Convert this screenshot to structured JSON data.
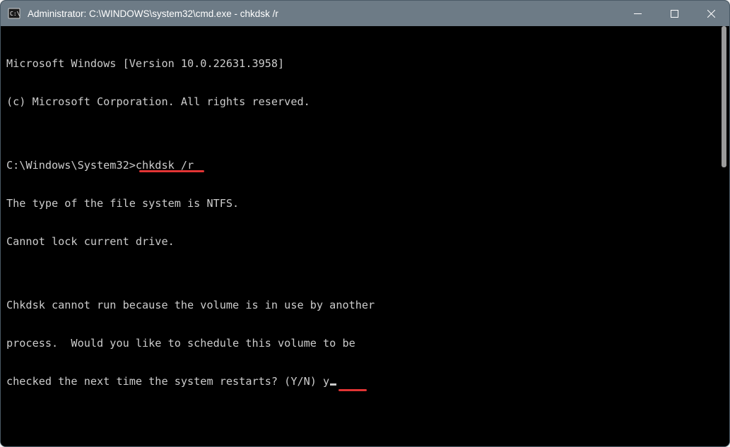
{
  "titlebar": {
    "title": "Administrator: C:\\WINDOWS\\system32\\cmd.exe - chkdsk  /r"
  },
  "terminal": {
    "line1": "Microsoft Windows [Version 10.0.22631.3958]",
    "line2": "(c) Microsoft Corporation. All rights reserved.",
    "blank1": "",
    "prompt_prefix": "C:\\Windows\\System32>",
    "prompt_command": "chkdsk /r",
    "line4": "The type of the file system is NTFS.",
    "line5": "Cannot lock current drive.",
    "blank2": "",
    "line6": "Chkdsk cannot run because the volume is in use by another",
    "line7": "process.  Would you like to schedule this volume to be",
    "line8_prefix": "checked the next time the system restarts? (Y/N) ",
    "line8_answer": "y"
  }
}
